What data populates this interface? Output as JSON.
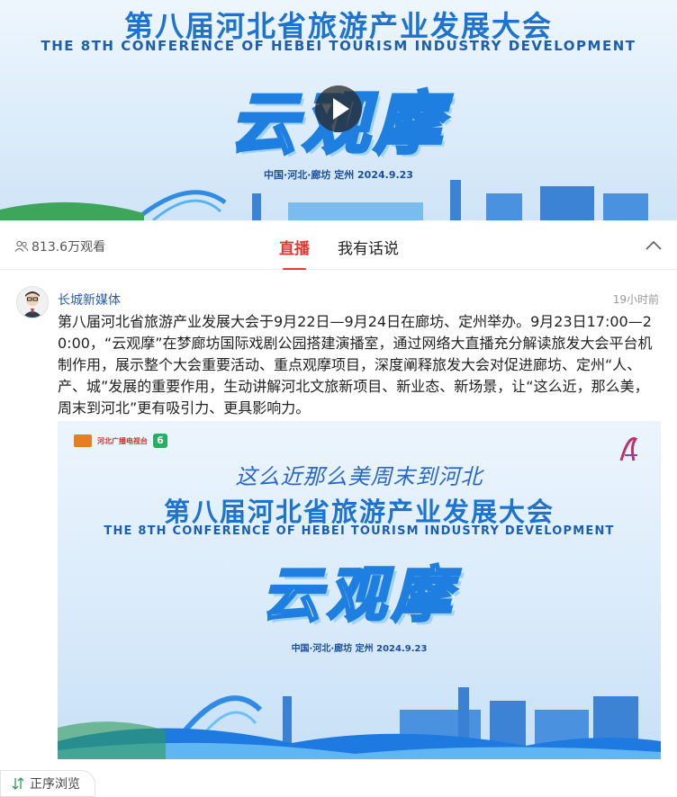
{
  "video": {
    "title_cn": "第八届河北省旅游产业发展大会",
    "title_en": "THE 8TH CONFERENCE OF HEBEI TOURISM  INDUSTRY DEVELOPMENT",
    "big_text": "云观摩",
    "date_line": "中国·河北·廊坊  定州    2024.9.23",
    "play_icon": "play-icon"
  },
  "tabs": {
    "viewers": "813.6万观看",
    "viewers_icon": "users-icon",
    "items": [
      {
        "label": "直播",
        "active": true
      },
      {
        "label": "我有话说",
        "active": false
      }
    ],
    "collapse_icon": "chevron-up-icon",
    "active_color": "#e53935"
  },
  "post": {
    "author": "长城新媒体",
    "time": "19小时前",
    "text": "第八届河北省旅游产业发展大会于9月22日—9月24日在廊坊、定州举办。9月23日17:00—20:00，“云观摩”在梦廊坊国际戏剧公园搭建演播室，通过网络大直播充分解读旅发大会平台机制作用，展示整个大会重要活动、重点观摩项目，深度阐释旅发大会对促进廊坊、定州“人、产、城”发展的重要作用，生动讲解河北文旅新项目、新业态、新场景，让“这么近，那么美，周末到河北”更有吸引力、更具影响力。",
    "image": {
      "slogan": "这么近那么美周末到河北",
      "title_cn": "第八届河北省旅游产业发展大会",
      "title_en": "THE 8TH CONFERENCE OF HEBEI TOURISM INDUSTRY DEVELOPMENT",
      "big_text": "云观摩",
      "date_line": "中国·河北·廊坊  定州    2024.9.23",
      "logo_text": "河北广播电视台",
      "logo_number": "6"
    }
  },
  "sort": {
    "label": "正序浏览",
    "icon": "sort-icon"
  }
}
